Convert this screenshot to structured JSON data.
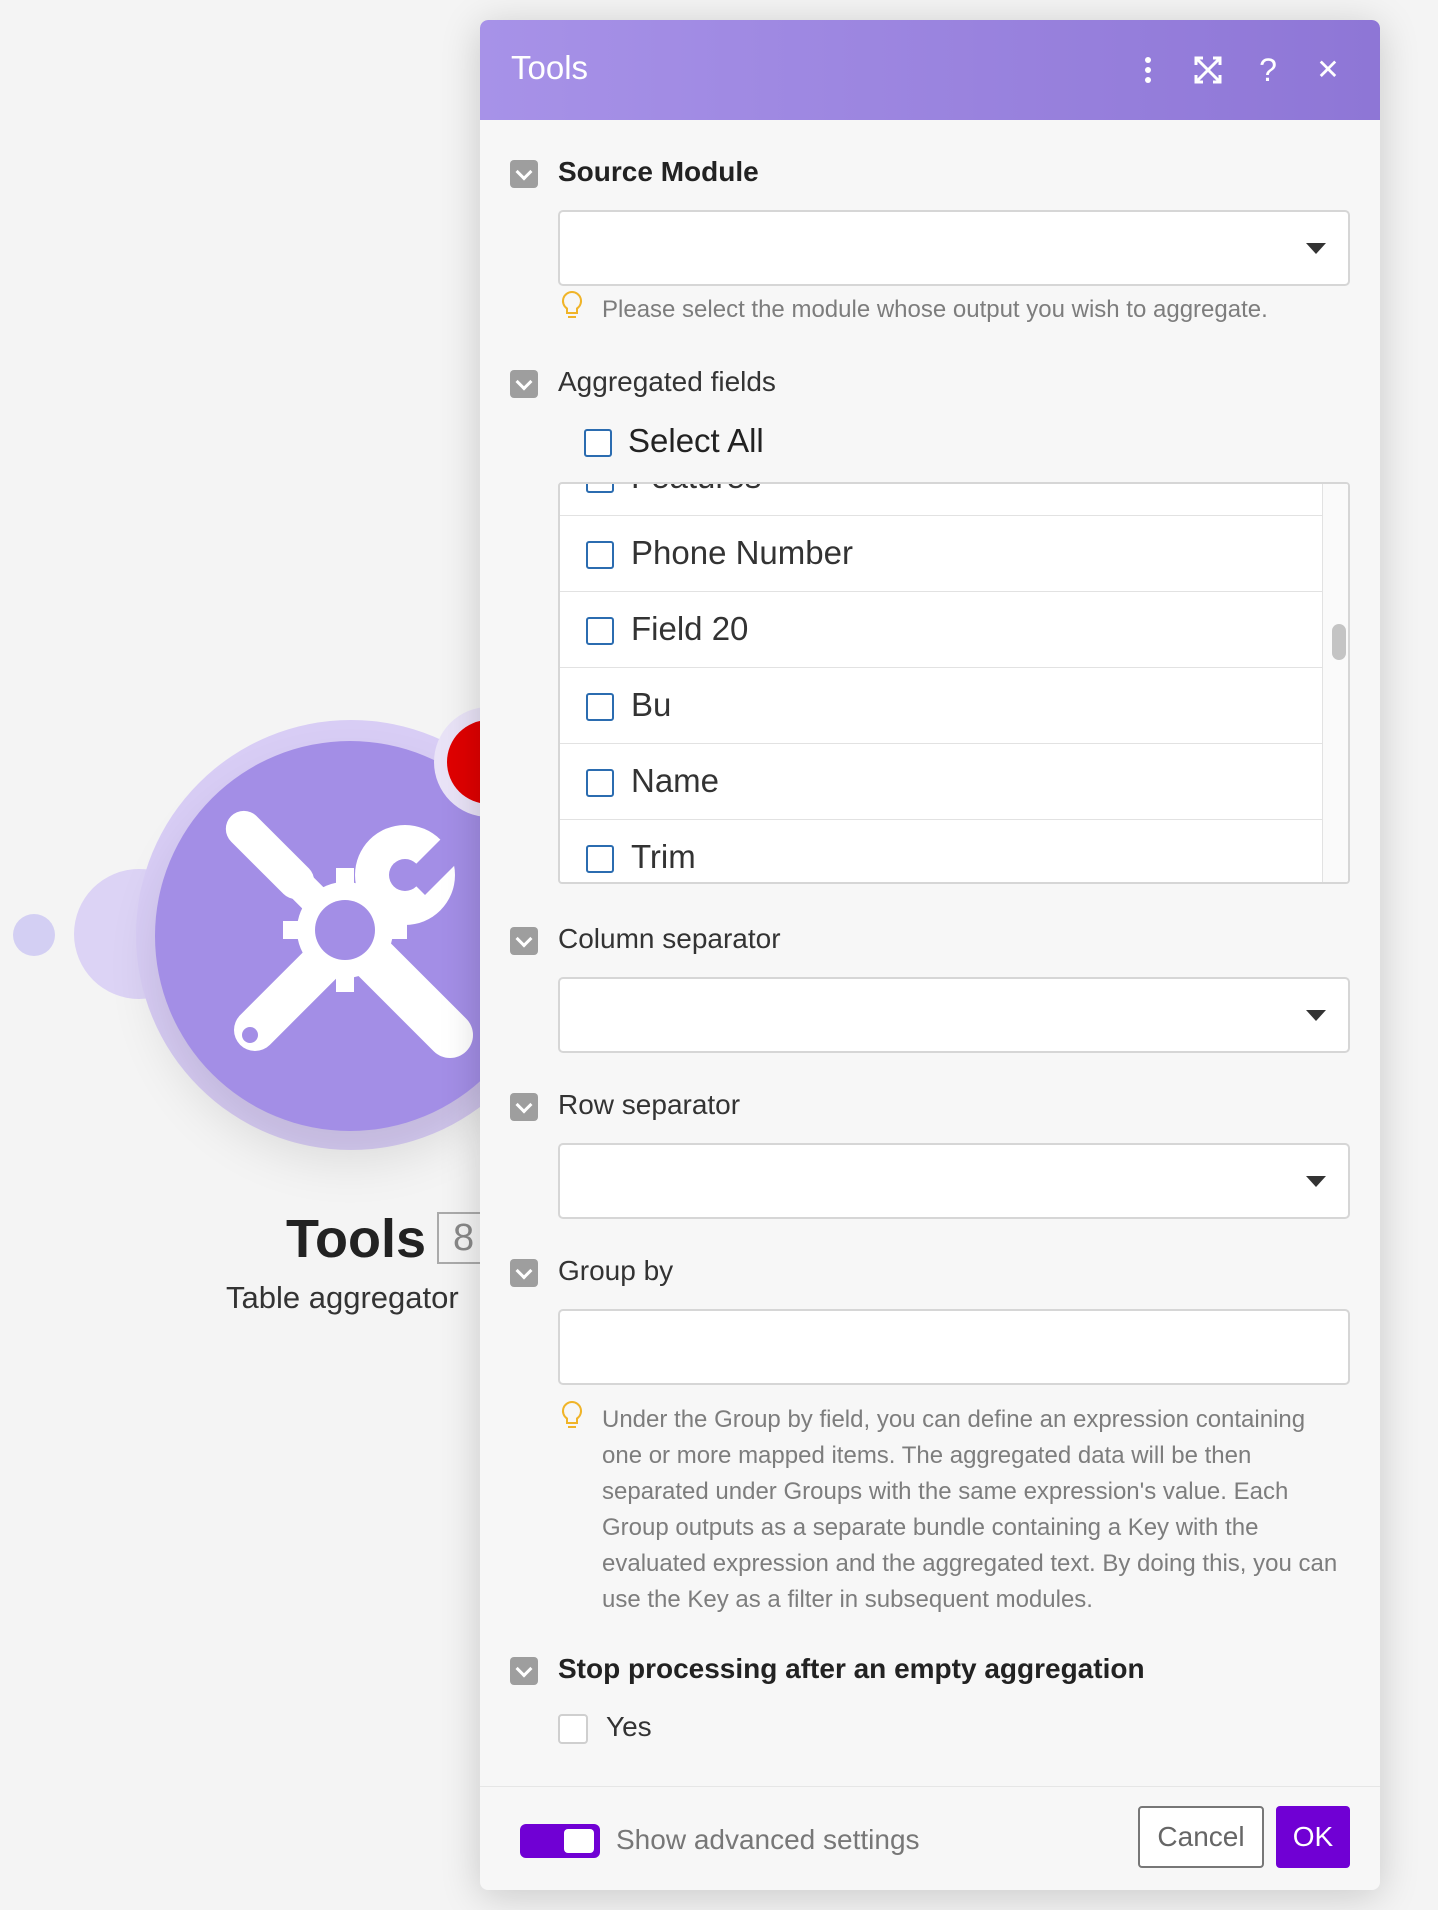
{
  "canvas": {
    "module_name": "Tools",
    "module_badge": "8",
    "module_subtitle": "Table aggregator"
  },
  "dialog": {
    "title": "Tools",
    "icons": [
      "more-vertical-icon",
      "expand-icon",
      "help-icon",
      "close-icon"
    ],
    "help_glyph": "?",
    "close_glyph": "✕",
    "source_module": {
      "label": "Source Module",
      "value": "",
      "hint": "Please select the module whose output you wish to aggregate."
    },
    "aggregated_fields": {
      "label": "Aggregated fields",
      "select_all_label": "Select All",
      "items": [
        {
          "label": "Features",
          "checked": false
        },
        {
          "label": "Phone Number",
          "checked": false
        },
        {
          "label": "Field 20",
          "checked": false
        },
        {
          "label": "Bu",
          "checked": false
        },
        {
          "label": "Name",
          "checked": false
        },
        {
          "label": "Trim",
          "checked": false
        }
      ]
    },
    "column_separator": {
      "label": "Column separator",
      "value": ""
    },
    "row_separator": {
      "label": "Row separator",
      "value": ""
    },
    "group_by": {
      "label": "Group by",
      "value": "",
      "hint": "Under the Group by field, you can define an expression containing one or more mapped items. The aggregated data will be then separated under Groups with the same expression's value. Each Group outputs as a separate bundle containing a Key with the evaluated expression and the aggregated text. By doing this, you can use the Key as a filter in subsequent modules."
    },
    "stop_processing": {
      "label": "Stop processing after an empty aggregation",
      "option_label": "Yes",
      "checked": false
    },
    "footer": {
      "advanced_label": "Show advanced settings",
      "advanced_on": true,
      "cancel_label": "Cancel",
      "ok_label": "OK"
    }
  },
  "colors": {
    "header_gradient_start": "#a792e8",
    "header_gradient_end": "#8e76d6",
    "primary_button": "#7000d4",
    "module_fill": "#a38ee6",
    "error_dot": "#e00000",
    "hint_icon": "#f0b429"
  }
}
